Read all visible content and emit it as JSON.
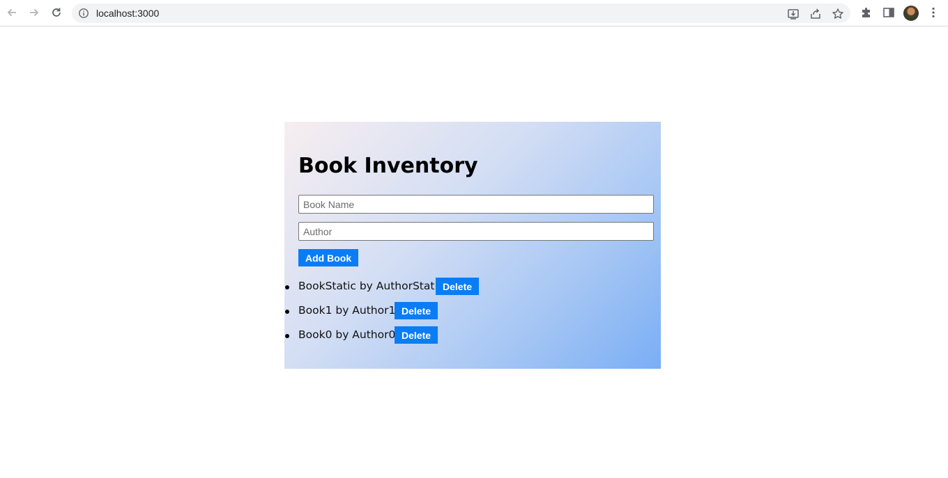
{
  "browser": {
    "url": "localhost:3000",
    "nav": [
      "arrow-back-icon",
      "arrow-forward-icon",
      "reload-icon"
    ],
    "omnibox_actions": [
      "install-icon",
      "share-icon",
      "bookmark-star-icon"
    ],
    "toolbar_actions": [
      "extensions-puzzle-icon",
      "side-panel-icon",
      "profile-avatar",
      "menu-kebab-icon"
    ]
  },
  "app": {
    "title": "Book Inventory",
    "form": {
      "book_name_placeholder": "Book Name",
      "book_name_value": "",
      "author_placeholder": "Author",
      "author_value": "",
      "add_label": "Add Book"
    },
    "books": [
      {
        "text": "BookStatic by AuthorStatic",
        "delete_label": "Delete"
      },
      {
        "text": "Book1 by Author1",
        "delete_label": "Delete"
      },
      {
        "text": "Book0 by Author0",
        "delete_label": "Delete"
      }
    ]
  },
  "colors": {
    "button_blue": "#0a7cf5",
    "gradient_start": "#f7eef0",
    "gradient_end": "#7aaef5"
  }
}
